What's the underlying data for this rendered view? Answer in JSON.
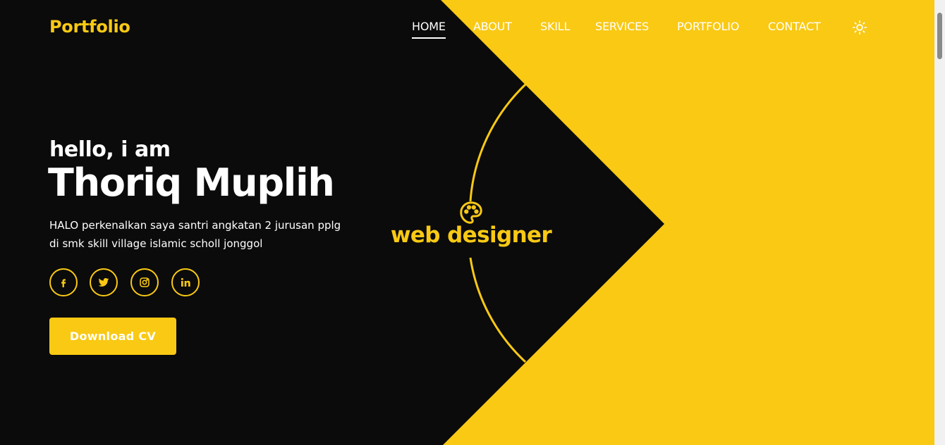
{
  "brand": "Portfolio",
  "nav": {
    "items": [
      {
        "label": "HOME",
        "active": true
      },
      {
        "label": "ABOUT"
      },
      {
        "label": "SKILL"
      },
      {
        "label": "SERVICES"
      },
      {
        "label": "PORTFOLIO"
      },
      {
        "label": "CONTACT"
      }
    ],
    "theme_icon": "sun-icon"
  },
  "hero": {
    "greeting": "hello, i am",
    "name": "Thoriq Muplih",
    "bio_line1": "HALO perkenalkan saya santri angkatan 2 jurusan pplg",
    "bio_line2": "di smk skill village islamic scholl jonggol",
    "cta_label": "Download CV",
    "role": "web designer",
    "role_icon": "palette-icon"
  },
  "socials": [
    {
      "name": "facebook-icon"
    },
    {
      "name": "twitter-icon"
    },
    {
      "name": "instagram-icon"
    },
    {
      "name": "linkedin-icon"
    }
  ],
  "colors": {
    "accent": "#f9c914",
    "background": "#0b0b0b",
    "text": "#ffffff"
  }
}
